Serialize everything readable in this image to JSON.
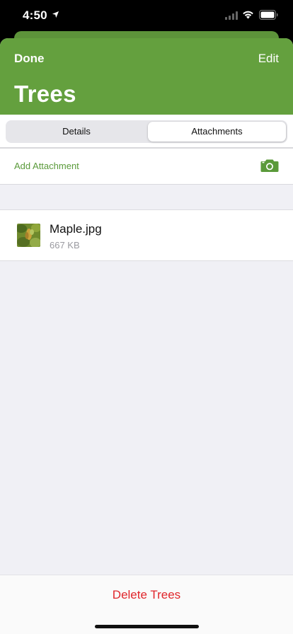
{
  "status_bar": {
    "time": "4:50"
  },
  "nav": {
    "done_label": "Done",
    "edit_label": "Edit",
    "title": "Trees"
  },
  "segments": {
    "details_label": "Details",
    "attachments_label": "Attachments",
    "selected": "Attachments"
  },
  "attachments": {
    "add_label": "Add Attachment",
    "files": [
      {
        "name": "Maple.jpg",
        "size": "667 KB"
      }
    ]
  },
  "footer": {
    "delete_label": "Delete Trees"
  },
  "colors": {
    "accent_green": "#64a03e",
    "link_green": "#5a9a3a",
    "destructive_red": "#e0262b"
  },
  "icons": [
    "location-arrow-icon",
    "signal-icon",
    "wifi-icon",
    "battery-icon",
    "camera-icon"
  ]
}
